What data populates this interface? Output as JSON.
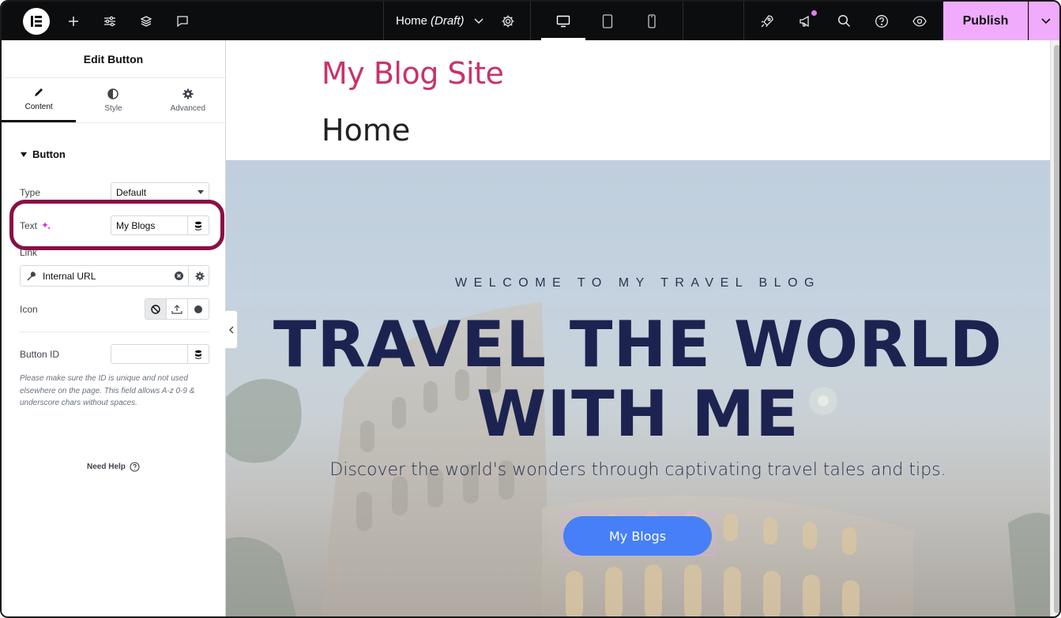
{
  "topbar": {
    "doc_name": "Home",
    "doc_status": "(Draft)",
    "publish_label": "Publish"
  },
  "panel": {
    "title": "Edit Button",
    "tabs": [
      {
        "label": "Content",
        "icon": "pencil-icon",
        "active": true
      },
      {
        "label": "Style",
        "icon": "half-circle-icon",
        "active": false
      },
      {
        "label": "Advanced",
        "icon": "gear-icon",
        "active": false
      }
    ],
    "section_title": "Button",
    "type_label": "Type",
    "type_value": "Default",
    "text_label": "Text",
    "text_value": "My Blogs",
    "link_label": "Link",
    "link_value": "Internal URL",
    "icon_label": "Icon",
    "button_id_label": "Button ID",
    "button_id_value": "",
    "help_note": "Please make sure the ID is unique and not used elsewhere on the page. This field allows A-z  0-9 & underscore chars without spaces.",
    "need_help": "Need Help"
  },
  "canvas": {
    "site_title": "My Blog Site",
    "page_title": "Home",
    "eyebrow": "WELCOME TO MY TRAVEL BLOG",
    "headline_line1": "TRAVEL THE WORLD",
    "headline_line2": "WITH ME",
    "subline": "Discover the world's wonders through captivating travel tales and tips.",
    "cta_label": "My Blogs"
  },
  "colors": {
    "topbar_bg": "#0c0d0e",
    "publish_bg": "#f0abfc",
    "site_title": "#c8336c",
    "headline": "#1d2350",
    "cta_bg": "#467ff7",
    "highlight_ring": "#8a0f45"
  }
}
